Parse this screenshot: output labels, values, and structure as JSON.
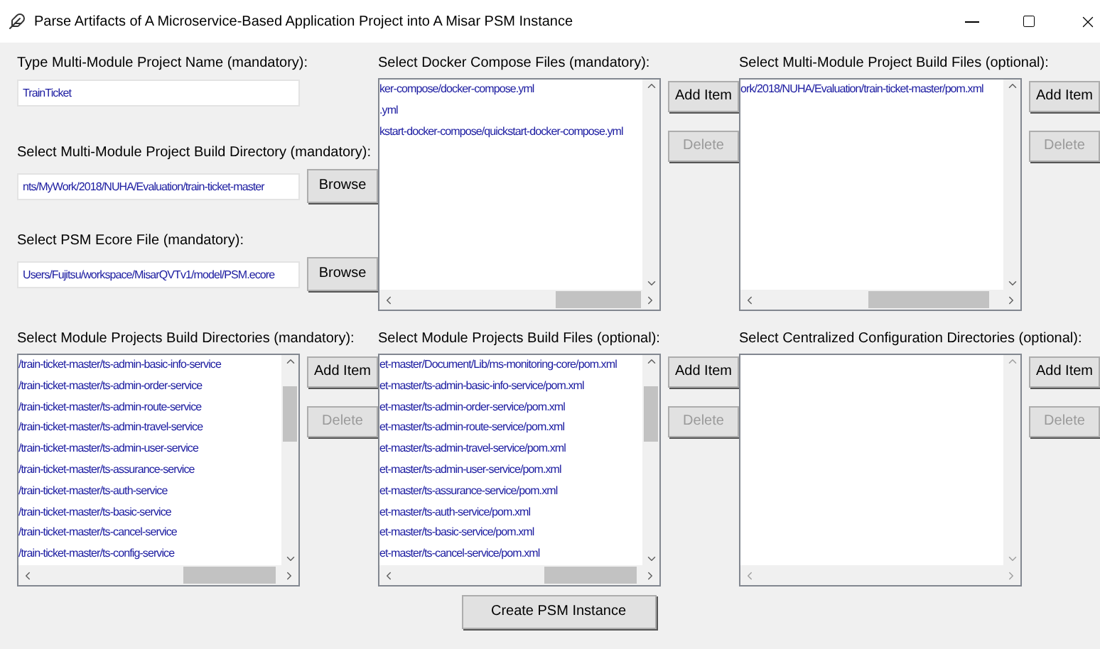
{
  "window": {
    "title": "Parse Artifacts of A Microservice-Based Application Project into A Misar PSM Instance"
  },
  "fields": [
    {
      "label": "Type Multi-Module Project Name (mandatory):",
      "value": "TrainTicket"
    },
    {
      "label": "Select Multi-Module Project Build Directory (mandatory):",
      "value": "nts/MyWork/2018/NUHA/Evaluation/train-ticket-master",
      "button": "Browse"
    },
    {
      "label": "Select PSM Ecore File (mandatory):",
      "value": "Users/Fujitsu/workspace/MisarQVTv1/model/PSM.ecore",
      "button": "Browse"
    }
  ],
  "lists": [
    {
      "label": "Select Docker Compose Files (mandatory):",
      "items": [
        "ker-compose/docker-compose.yml",
        ".yml",
        "kstart-docker-compose/quickstart-docker-compose.yml"
      ],
      "buttons": [
        {
          "label": "Add Item",
          "disabled": false
        },
        {
          "label": "Delete",
          "disabled": true
        }
      ]
    },
    {
      "label": "Select Multi-Module Project Build Files (optional):",
      "items": [
        "ork/2018/NUHA/Evaluation/train-ticket-master/pom.xml"
      ],
      "buttons": [
        {
          "label": "Add Item",
          "disabled": false
        },
        {
          "label": "Delete",
          "disabled": true
        }
      ]
    },
    {
      "label": "Select Module Projects Build Directories (mandatory):",
      "items": [
        "/train-ticket-master/ts-admin-basic-info-service",
        "/train-ticket-master/ts-admin-order-service",
        "/train-ticket-master/ts-admin-route-service",
        "/train-ticket-master/ts-admin-travel-service",
        "/train-ticket-master/ts-admin-user-service",
        "/train-ticket-master/ts-assurance-service",
        "/train-ticket-master/ts-auth-service",
        "/train-ticket-master/ts-basic-service",
        "/train-ticket-master/ts-cancel-service",
        "/train-ticket-master/ts-config-service"
      ],
      "buttons": [
        {
          "label": "Add Item",
          "disabled": false
        },
        {
          "label": "Delete",
          "disabled": true
        }
      ]
    },
    {
      "label": "Select Module Projects Build Files (optional):",
      "items": [
        "et-master/Document/Lib/ms-monitoring-core/pom.xml",
        "et-master/ts-admin-basic-info-service/pom.xml",
        "et-master/ts-admin-order-service/pom.xml",
        "et-master/ts-admin-route-service/pom.xml",
        "et-master/ts-admin-travel-service/pom.xml",
        "et-master/ts-admin-user-service/pom.xml",
        "et-master/ts-assurance-service/pom.xml",
        "et-master/ts-auth-service/pom.xml",
        "et-master/ts-basic-service/pom.xml",
        "et-master/ts-cancel-service/pom.xml"
      ],
      "buttons": [
        {
          "label": "Add Item",
          "disabled": false
        },
        {
          "label": "Delete",
          "disabled": true
        }
      ]
    },
    {
      "label": "Select Centralized Configuration Directories (optional):",
      "buttons": [
        {
          "label": "Add Item",
          "disabled": false
        },
        {
          "label": "Delete",
          "disabled": true
        }
      ]
    }
  ],
  "create_button": "Create PSM Instance"
}
